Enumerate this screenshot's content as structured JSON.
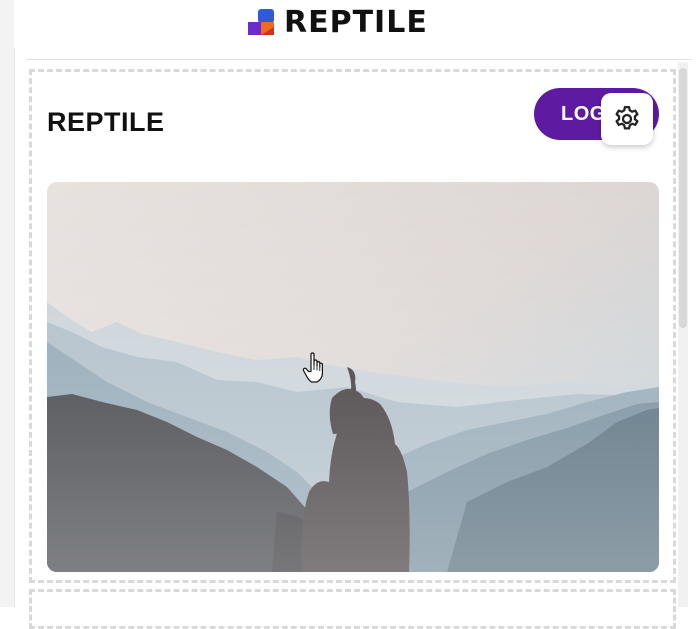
{
  "header": {
    "brand_name": "REPTILE",
    "logo_colors": {
      "top": "#2f5bd9",
      "bottom_left": "#6a2bd1",
      "bottom_right": "#f26a1b"
    }
  },
  "main": {
    "site_title": "REPTILE",
    "login_label": "LOGIN",
    "settings_icon": "gear-icon",
    "hero_image": "mountain-landscape-hooded-person"
  },
  "colors": {
    "accent": "#5e1ba1",
    "title_text": "#111111",
    "dashed_border": "#d9d9d9"
  }
}
